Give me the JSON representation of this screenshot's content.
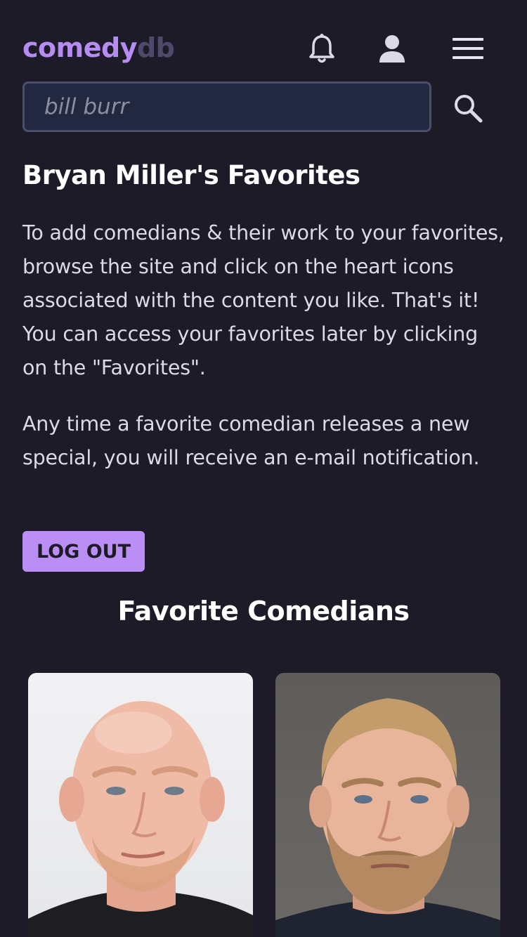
{
  "header": {
    "logo_part1": "comedy",
    "logo_part2": "db",
    "icons": [
      "bell-icon",
      "user-icon",
      "menu-icon"
    ]
  },
  "search": {
    "placeholder": "bill burr",
    "value": "",
    "button_icon": "search-icon"
  },
  "main": {
    "title": "Bryan Miller's Favorites",
    "paragraph1": "To add comedians & their work to your favorites, browse the site and click on the heart icons associated with the content you like. That's it! You can access your favorites later by clicking on the \"Favorites\".",
    "paragraph2": "Any time a favorite comedian releases a new special, you will receive an e-mail notification.",
    "logout_label": "LOG OUT"
  },
  "favorites": {
    "section_title": "Favorite Comedians",
    "cards": [
      {
        "photo": "comedian-photo"
      },
      {
        "photo": "comedian-photo"
      }
    ]
  },
  "colors": {
    "background": "#1c1b27",
    "accent": "#bb8ef5",
    "logo_secondary": "#4f4a6b",
    "search_bg": "#222840",
    "search_border": "#4a4e6b"
  }
}
